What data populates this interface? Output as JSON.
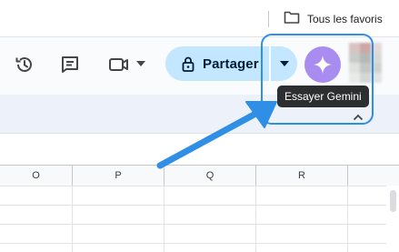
{
  "bookmarks": {
    "folder_label": "Tous les favoris",
    "folder_icon": "folder-icon"
  },
  "toolbar": {
    "icons": [
      "history-icon",
      "comment-icon",
      "video-call-icon",
      "chevron-down-icon"
    ],
    "share_label": "Partager",
    "share_icon": "lock-icon",
    "gemini_icon": "gemini-sparkle-icon"
  },
  "tooltip": {
    "text": "Essayer Gemini"
  },
  "sheet": {
    "columns": [
      "O",
      "P",
      "Q",
      "R"
    ]
  },
  "colors": {
    "share_bg": "#c2e7ff",
    "gemini_bg": "#a98cf0",
    "highlight": "#2f8ee6",
    "tooltip_bg": "#2d2e30"
  }
}
